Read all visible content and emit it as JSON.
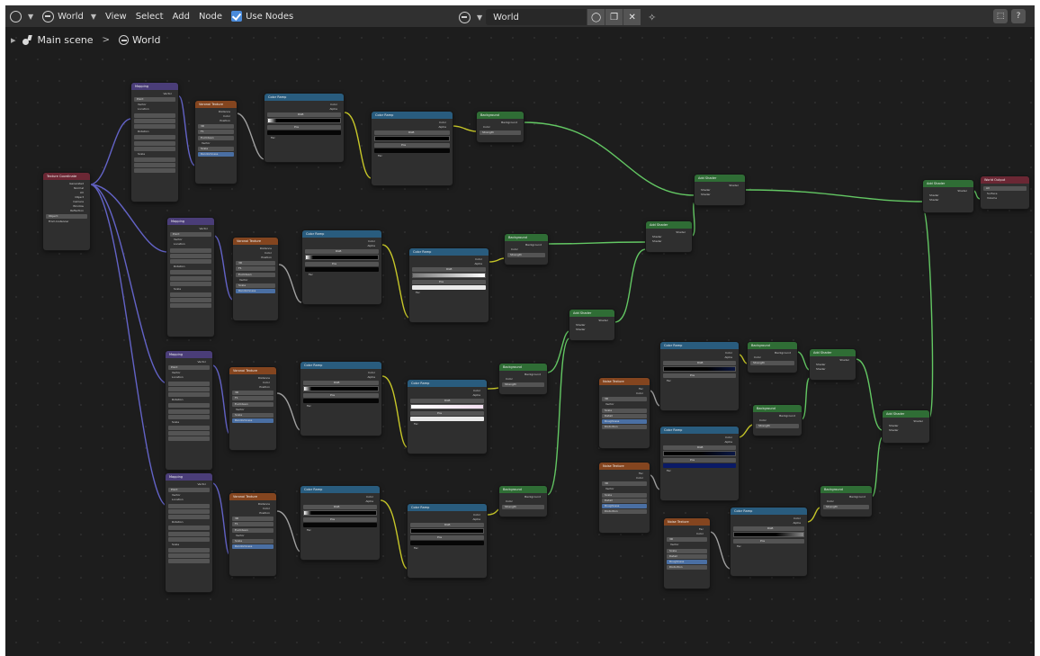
{
  "header": {
    "editor_type_icon": "node-editor-icon",
    "world_label": "World",
    "menus": [
      "View",
      "Select",
      "Add",
      "Node"
    ],
    "use_nodes_label": "Use Nodes",
    "use_nodes_checked": true,
    "datablock_name": "World"
  },
  "breadcrumb": {
    "scene": "Main scene",
    "world": "World"
  },
  "colors": {
    "canvas": "#1d1d1d",
    "header": "#303030",
    "link_vector": "#6363c7",
    "link_color": "#c7c729",
    "link_shader": "#63c763",
    "checkbox": "#4a8bdb",
    "node_header_blue": "#295c7e",
    "node_header_green": "#2f6d35",
    "node_header_orange": "#84451f",
    "node_header_red": "#6b2734"
  },
  "nodes": {
    "texcoord": {
      "title": "Texture Coordinate",
      "outputs": [
        "Generated",
        "Normal",
        "UV",
        "Object",
        "Camera",
        "Window",
        "Reflection"
      ],
      "object_label": "Object:",
      "from_instancer": "From Instancer"
    },
    "mapping_title": "Mapping",
    "vector_out": "Vector",
    "type_label": "Type:",
    "type_value": "Point",
    "vector_in": "Vector",
    "location": "Location",
    "rotation": "Rotation",
    "scale": "Scale",
    "voronoi_title": "Voronoi Texture",
    "voronoi_outputs": [
      "Distance",
      "Color",
      "Position"
    ],
    "dim": "3D",
    "f1": "F1",
    "euclidean": "Euclidean",
    "scale_label": "Scale",
    "randomness_label": "Randomness",
    "colorramp_title": "Color Ramp",
    "ramp_outputs": [
      "Color",
      "Alpha"
    ],
    "rgb": "RGB",
    "linear": "Linear",
    "pos": "Pos",
    "fac": "Fac",
    "background_title": "Background",
    "background_out": "Background",
    "color_in": "Color",
    "strength_label": "Strength",
    "add_shader_title": "Add Shader",
    "shader": "Shader",
    "noise_title": "Noise Texture",
    "noise_outputs": [
      "Fac",
      "Color"
    ],
    "detail_label": "Detail",
    "roughness_label": "Roughness",
    "distortion_label": "Distortion",
    "world_output": {
      "title": "World Output",
      "target": "All",
      "inputs": [
        "Surface",
        "Volume"
      ]
    }
  }
}
